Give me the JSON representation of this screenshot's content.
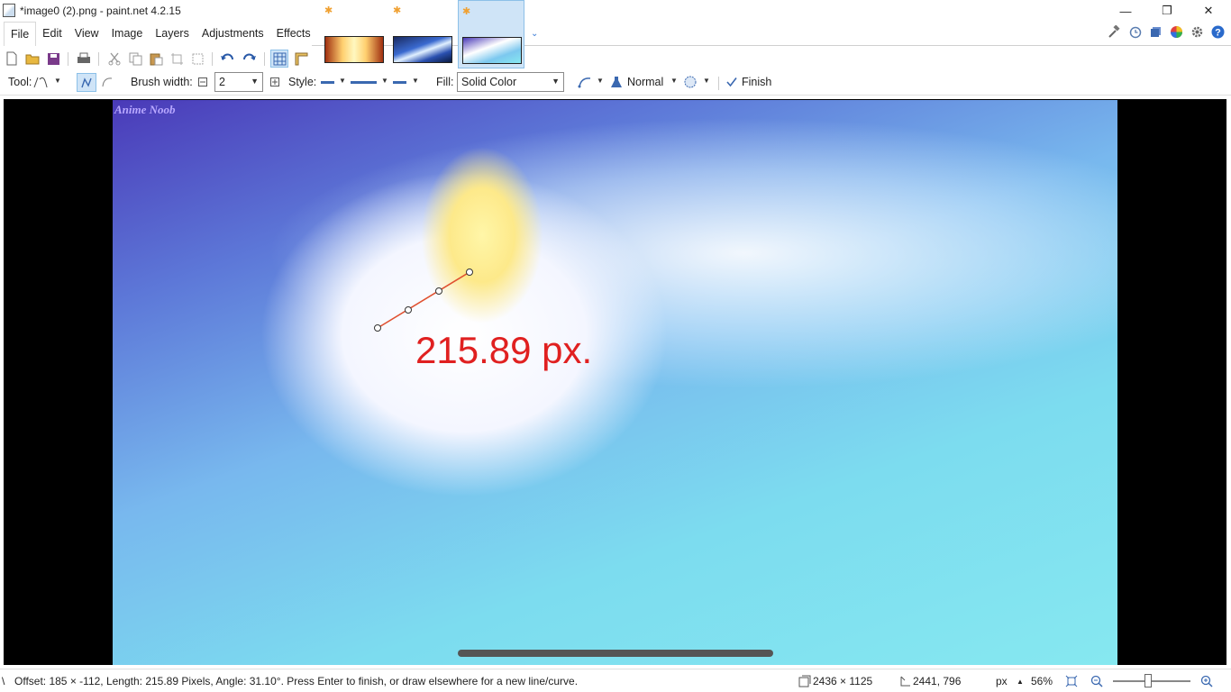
{
  "window": {
    "title": "*image0 (2).png - paint.net 4.2.15",
    "minimize_glyph": "—",
    "restore_glyph": "❐",
    "close_glyph": "✕"
  },
  "menu": {
    "items": [
      "File",
      "Edit",
      "View",
      "Image",
      "Layers",
      "Adjustments",
      "Effects"
    ]
  },
  "image_tabs": {
    "modified_marker": "✱",
    "more_glyph": "⌄"
  },
  "top_icons": [
    "hammer-icon",
    "history-icon",
    "layers-icon",
    "colors-icon",
    "settings-icon",
    "help-icon"
  ],
  "toolbar": {
    "tool_label": "Tool:",
    "brush_width_label": "Brush width:",
    "brush_width_value": "2",
    "style_label": "Style:",
    "fill_label": "Fill:",
    "fill_value": "Solid Color",
    "blend_mode": "Normal",
    "finish_label": "Finish"
  },
  "canvas": {
    "watermark": "Anime Noob",
    "measurement": "215.89 px."
  },
  "status": {
    "message": "Offset: 185 × -112, Length: 215.89 Pixels, Angle: 31.10°. Press Enter to finish, or draw elsewhere for a new line/curve.",
    "image_size": "2436 × 1125",
    "cursor_pos": "2441, 796",
    "units": "px",
    "zoom": "56%"
  },
  "colors": {
    "accent": "#3a68b0",
    "measure_red": "#e02020",
    "tab_active": "#cfe4f7"
  }
}
